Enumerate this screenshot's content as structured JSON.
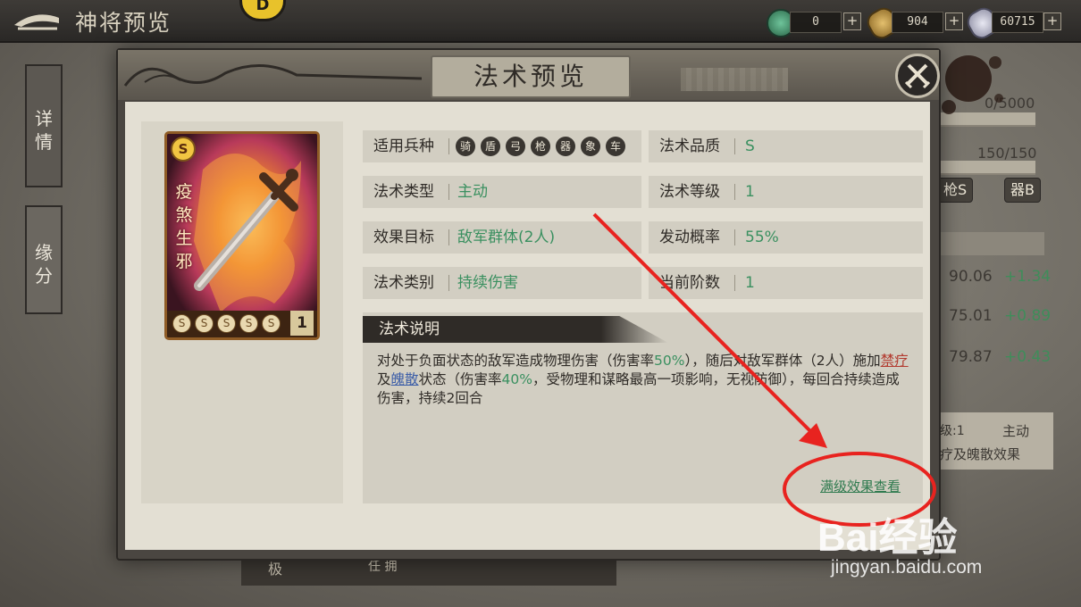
{
  "top_bar": {
    "page_title": "神将预览",
    "badge_letter": "D",
    "resources": [
      {
        "icon": "jade-coin-icon",
        "value": "0",
        "plus": "+"
      },
      {
        "icon": "copper-coin-icon",
        "value": "904",
        "plus": "+"
      },
      {
        "icon": "silver-ingot-icon",
        "value": "60715",
        "plus": "+"
      }
    ]
  },
  "side_tabs": [
    {
      "label": "详情"
    },
    {
      "label": "缘分"
    }
  ],
  "background_panel": {
    "bar1_value": "0/5000",
    "bar2_value": "150/150",
    "tag_spear": "枪S",
    "tag_weapon": "器B",
    "stats": [
      {
        "value": "90.06",
        "delta": "+1.34"
      },
      {
        "value": "75.01",
        "delta": "+0.89"
      },
      {
        "value": "79.87",
        "delta": "+0.43"
      }
    ],
    "skill_line1_left": "级:1",
    "skill_line1_right": "主动",
    "skill_line2": "疗及魄散效果",
    "bottom_tab_left": "极",
    "bottom_tab_right": "任   拥"
  },
  "modal": {
    "title": "法术预览",
    "card": {
      "grade": "S",
      "name": "疫煞生邪",
      "level": "1",
      "stars": [
        "S",
        "S",
        "S",
        "S",
        "S"
      ]
    },
    "attributes": {
      "troop_label": "适用兵种",
      "troop_icons": [
        "骑",
        "盾",
        "弓",
        "枪",
        "器",
        "象",
        "车"
      ],
      "quality_label": "法术品质",
      "quality_value": "S",
      "type_label": "法术类型",
      "type_value": "主动",
      "level_label": "法术等级",
      "level_value": "1",
      "target_label": "效果目标",
      "target_value": "敌军群体(2人)",
      "rate_label": "发动概率",
      "rate_value": "55%",
      "category_label": "法术类别",
      "category_value": "持续伤害",
      "stage_label": "当前阶数",
      "stage_value": "1"
    },
    "description": {
      "title": "法术说明",
      "part1": "对处于负面状态的敌军造成物理伤害（伤害率",
      "pct1": "50%",
      "part2": "），随后对敌军群体（2人）施加",
      "status1": "禁疗",
      "part3": "及",
      "status2": "魄散",
      "part4": "状态（伤害率",
      "pct2": "40%",
      "part5": "，受物理和谋略最高一项影响，无视防御），每回合持续造成伤害，持续2回合"
    },
    "max_level_link": "满级效果查看"
  },
  "watermark": {
    "brand": "Bai经验",
    "url": "jingyan.baidu.com"
  }
}
